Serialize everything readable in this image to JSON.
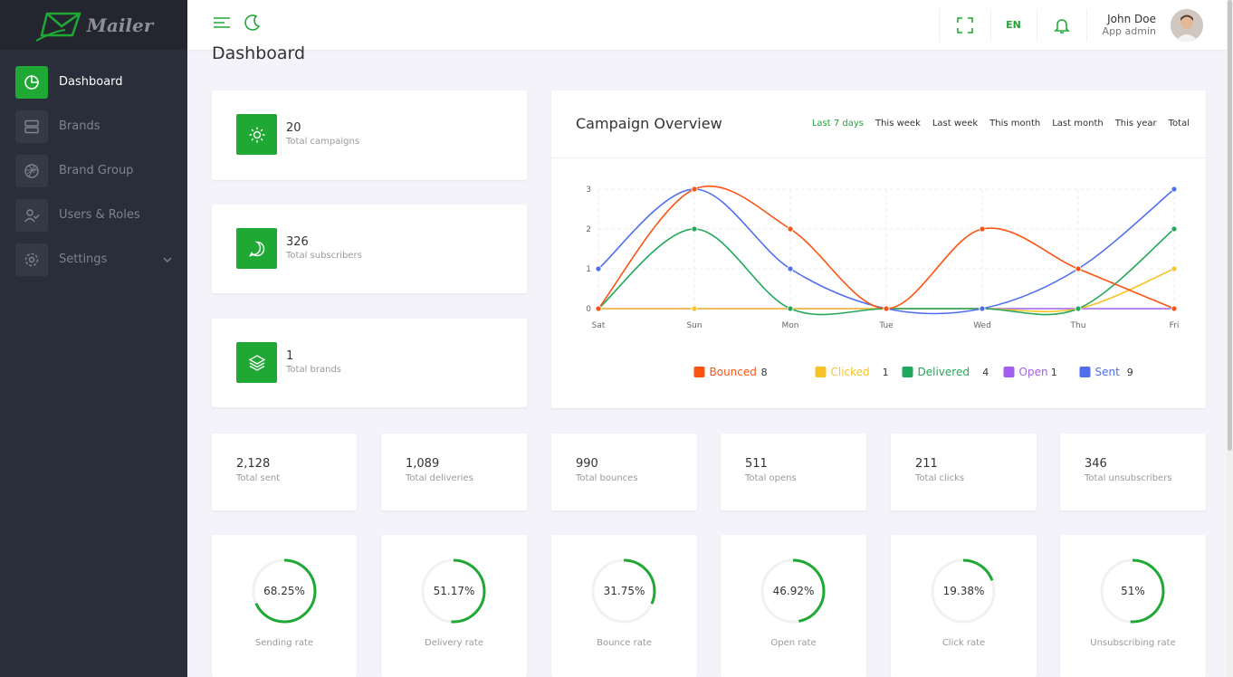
{
  "brand": {
    "name": "Mailer"
  },
  "nav": [
    {
      "label": "Dashboard",
      "active": true
    },
    {
      "label": "Brands"
    },
    {
      "label": "Brand Group"
    },
    {
      "label": "Users & Roles"
    },
    {
      "label": "Settings"
    }
  ],
  "topbar": {
    "lang": "EN",
    "user_name": "John Doe",
    "user_role": "App admin"
  },
  "page": {
    "title": "Dashboard"
  },
  "stats": [
    {
      "value": "20",
      "label": "Total campaigns"
    },
    {
      "value": "326",
      "label": "Total subscribers"
    },
    {
      "value": "1",
      "label": "Total brands"
    }
  ],
  "overview": {
    "title": "Campaign Overview",
    "filters": [
      "Last 7 days",
      "This week",
      "Last week",
      "This month",
      "Last month",
      "This year",
      "Total"
    ],
    "active_filter": "Last 7 days"
  },
  "chart_data": {
    "type": "line",
    "x": [
      "Sat",
      "Sun",
      "Mon",
      "Tue",
      "Wed",
      "Thu",
      "Fri"
    ],
    "yticks": [
      0,
      1,
      2,
      3
    ],
    "ylim": [
      0,
      3
    ],
    "series": [
      {
        "name": "Bounced",
        "total": "8",
        "color": "#fd5312",
        "values": [
          0,
          3,
          2,
          0,
          2,
          1,
          0
        ]
      },
      {
        "name": "Clicked",
        "total": "1",
        "color": "#f7c326",
        "values": [
          0,
          0,
          0,
          0,
          0,
          0,
          1
        ]
      },
      {
        "name": "Delivered",
        "total": "4",
        "color": "#22a85a",
        "values": [
          0,
          2,
          0,
          0,
          0,
          0,
          2
        ]
      },
      {
        "name": "Open",
        "total": "1",
        "color": "#a25ff2",
        "values": [
          0,
          0,
          0,
          0,
          0,
          0,
          0
        ]
      },
      {
        "name": "Sent",
        "total": "9",
        "color": "#4f6ef0",
        "values": [
          1,
          3,
          1,
          0,
          0,
          1,
          3
        ]
      }
    ],
    "legend": "bottom",
    "grid": true
  },
  "totals": [
    {
      "value": "2,128",
      "label": "Total sent"
    },
    {
      "value": "1,089",
      "label": "Total deliveries"
    },
    {
      "value": "990",
      "label": "Total bounces"
    },
    {
      "value": "511",
      "label": "Total opens"
    },
    {
      "value": "211",
      "label": "Total clicks"
    },
    {
      "value": "346",
      "label": "Total unsubscribers"
    }
  ],
  "rates": [
    {
      "value": "68.25%",
      "label": "Sending rate",
      "fraction": 0.6825
    },
    {
      "value": "51.17%",
      "label": "Delivery rate",
      "fraction": 0.5117
    },
    {
      "value": "31.75%",
      "label": "Bounce rate",
      "fraction": 0.3175
    },
    {
      "value": "46.92%",
      "label": "Open rate",
      "fraction": 0.4692
    },
    {
      "value": "19.38%",
      "label": "Click rate",
      "fraction": 0.1938
    },
    {
      "value": "51%",
      "label": "Unsubscribing rate",
      "fraction": 0.51
    }
  ],
  "colors": {
    "accent": "#20a835",
    "sidebar": "#2a2e3a"
  }
}
